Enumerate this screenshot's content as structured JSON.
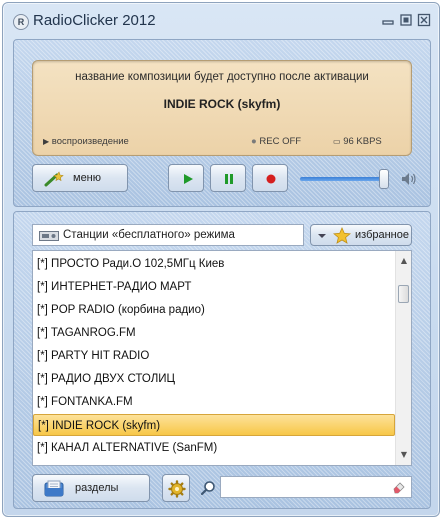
{
  "window": {
    "title": "RadioClicker 2012",
    "app_icon_letter": "R"
  },
  "display": {
    "message": "название композиции будет доступно после активации",
    "station": "INDIE ROCK (skyfm)",
    "status_label": "воспроизведение",
    "rec_status": "REC OFF",
    "bitrate": "96 KBPS"
  },
  "controls": {
    "menu_label": "меню",
    "volume_level": 0.88
  },
  "stations": {
    "source_label": "Станции «бесплатного» режима",
    "favorites_label": "избранное",
    "items": [
      {
        "label": "[*] ПРОСТО Ради.О 102,5МГц Киев"
      },
      {
        "label": "[*] ИНТЕРНЕТ-РАДИО МАРТ"
      },
      {
        "label": "[*] POP RADIO (корбина радио)"
      },
      {
        "label": "[*] TAGANROG.FM"
      },
      {
        "label": "[*] PARTY HIT RADIO"
      },
      {
        "label": "[*] РАДИО ДВУХ СТОЛИЦ"
      },
      {
        "label": "[*] FONTANKA.FM"
      },
      {
        "label": "[*] INDIE ROCK (skyfm)"
      },
      {
        "label": "[*] КАНАЛ ALTERNATIVE (SanFM)"
      }
    ],
    "selected_index": 7
  },
  "footer": {
    "sections_label": "разделы",
    "search_value": ""
  },
  "colors": {
    "accent_blue": "#3b7fd6",
    "selection": "#f7c748",
    "display_bg": "#ecd2a8",
    "play_green": "#1f9a2a",
    "rec_red": "#d51f1f"
  }
}
